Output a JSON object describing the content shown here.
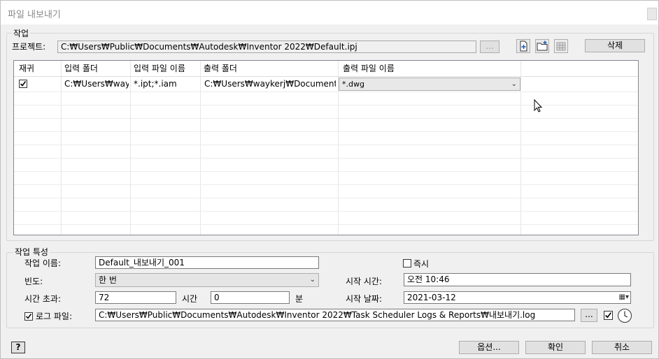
{
  "window": {
    "title": "파일 내보내기"
  },
  "job_group": {
    "label": "작업",
    "project_label": "프로젝트:",
    "project_path": "C:₩Users₩Public₩Documents₩Autodesk₩Inventor 2022₩Default.ipj",
    "browse_label": "...",
    "delete_label": "삭제"
  },
  "grid": {
    "headers": [
      "재귀",
      "입력 폴더",
      "입력 파일 이름",
      "출력 폴더",
      "출력 파일 이름"
    ],
    "rows": [
      {
        "recursive": true,
        "input_folder": "C:₩Users₩way...",
        "input_filename": "*.ipt;*.iam",
        "output_folder": "C:₩Users₩waykerj₩Documents₩...",
        "output_filename": "*.dwg"
      }
    ]
  },
  "props_group": {
    "label": "작업 특성",
    "name_label": "작업 이름:",
    "name_value": "Default_내보내기_001",
    "immediate_label": "즉시",
    "frequency_label": "빈도:",
    "frequency_value": "한 번",
    "start_time_label": "시작 시간:",
    "start_time_value": "오전 10:46",
    "timeout_label": "시간 초과:",
    "timeout_hours": "72",
    "hours_unit": "시간",
    "timeout_minutes": "0",
    "minutes_unit": "분",
    "start_date_label": "시작 날짜:",
    "start_date_value": "2021-03-12",
    "log_label": "로그 파일:",
    "log_path": "C:₩Users₩Public₩Documents₩Autodesk₩Inventor 2022₩Task Scheduler Logs & Reports₩내보내기.log",
    "log_browse": "..."
  },
  "footer": {
    "help_label": "?",
    "options_label": "옵션...",
    "ok_label": "확인",
    "cancel_label": "취소"
  }
}
